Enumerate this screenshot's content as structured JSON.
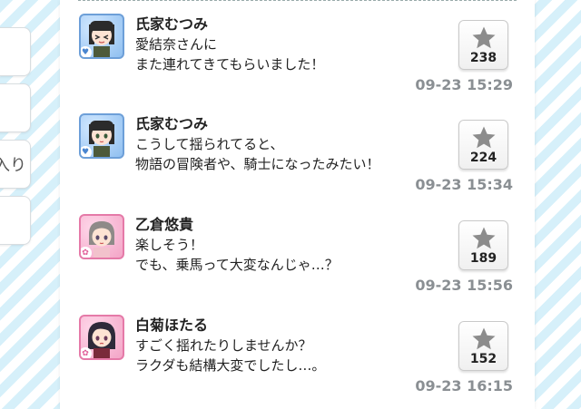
{
  "side_tabs": [
    "",
    "",
    "入り",
    ""
  ],
  "posts": [
    {
      "name": "氏家むつみ",
      "lines": [
        "愛結奈さんに",
        "また連れてきてもらいました！"
      ],
      "likes": "238",
      "time": "09-23 15:29",
      "frame_color": "#6d9fd8",
      "badge_icon": "heart-icon"
    },
    {
      "name": "氏家むつみ",
      "lines": [
        "こうして揺られてると、",
        "物語の冒険者や、騎士になったみたい！"
      ],
      "likes": "224",
      "time": "09-23 15:34",
      "frame_color": "#6d9fd8",
      "badge_icon": "heart-icon"
    },
    {
      "name": "乙倉悠貴",
      "lines": [
        "楽しそう！",
        "でも、乗馬って大変なんじゃ…？"
      ],
      "likes": "189",
      "time": "09-23 15:56",
      "frame_color": "#e57aa8",
      "badge_icon": "flower-icon"
    },
    {
      "name": "白菊ほたる",
      "lines": [
        "すごく揺れたりしませんか？",
        "ラクダも結構大変でしたし…。"
      ],
      "likes": "152",
      "time": "09-23 16:15",
      "frame_color": "#e57aa8",
      "badge_icon": "flower-icon"
    }
  ]
}
